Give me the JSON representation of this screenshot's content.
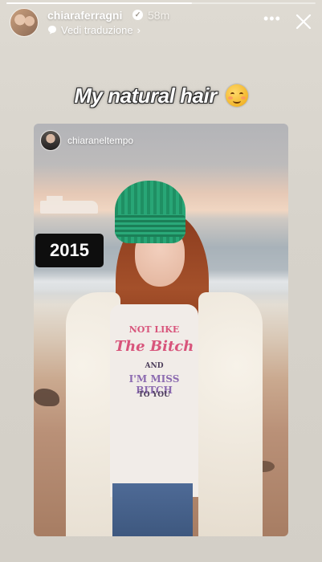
{
  "story": {
    "progress_percent": 60,
    "username": "chiaraferragni",
    "verified": true,
    "time": "58m",
    "translate_label": "Vedi traduzione",
    "caption": "My natural hair",
    "caption_emoji": "smiling-face-emoji"
  },
  "card": {
    "username": "chiaraneltempo",
    "year_badge": "2015",
    "shirt_lines": [
      "NOT LIKE",
      "The Bitch",
      "AND",
      "I'M MISS BITCH",
      "TO YOU"
    ]
  },
  "icons": {
    "more": "more-horizontal-icon",
    "close": "close-icon",
    "translate": "translate-bubble-icon",
    "verified": "verified-badge-icon"
  }
}
